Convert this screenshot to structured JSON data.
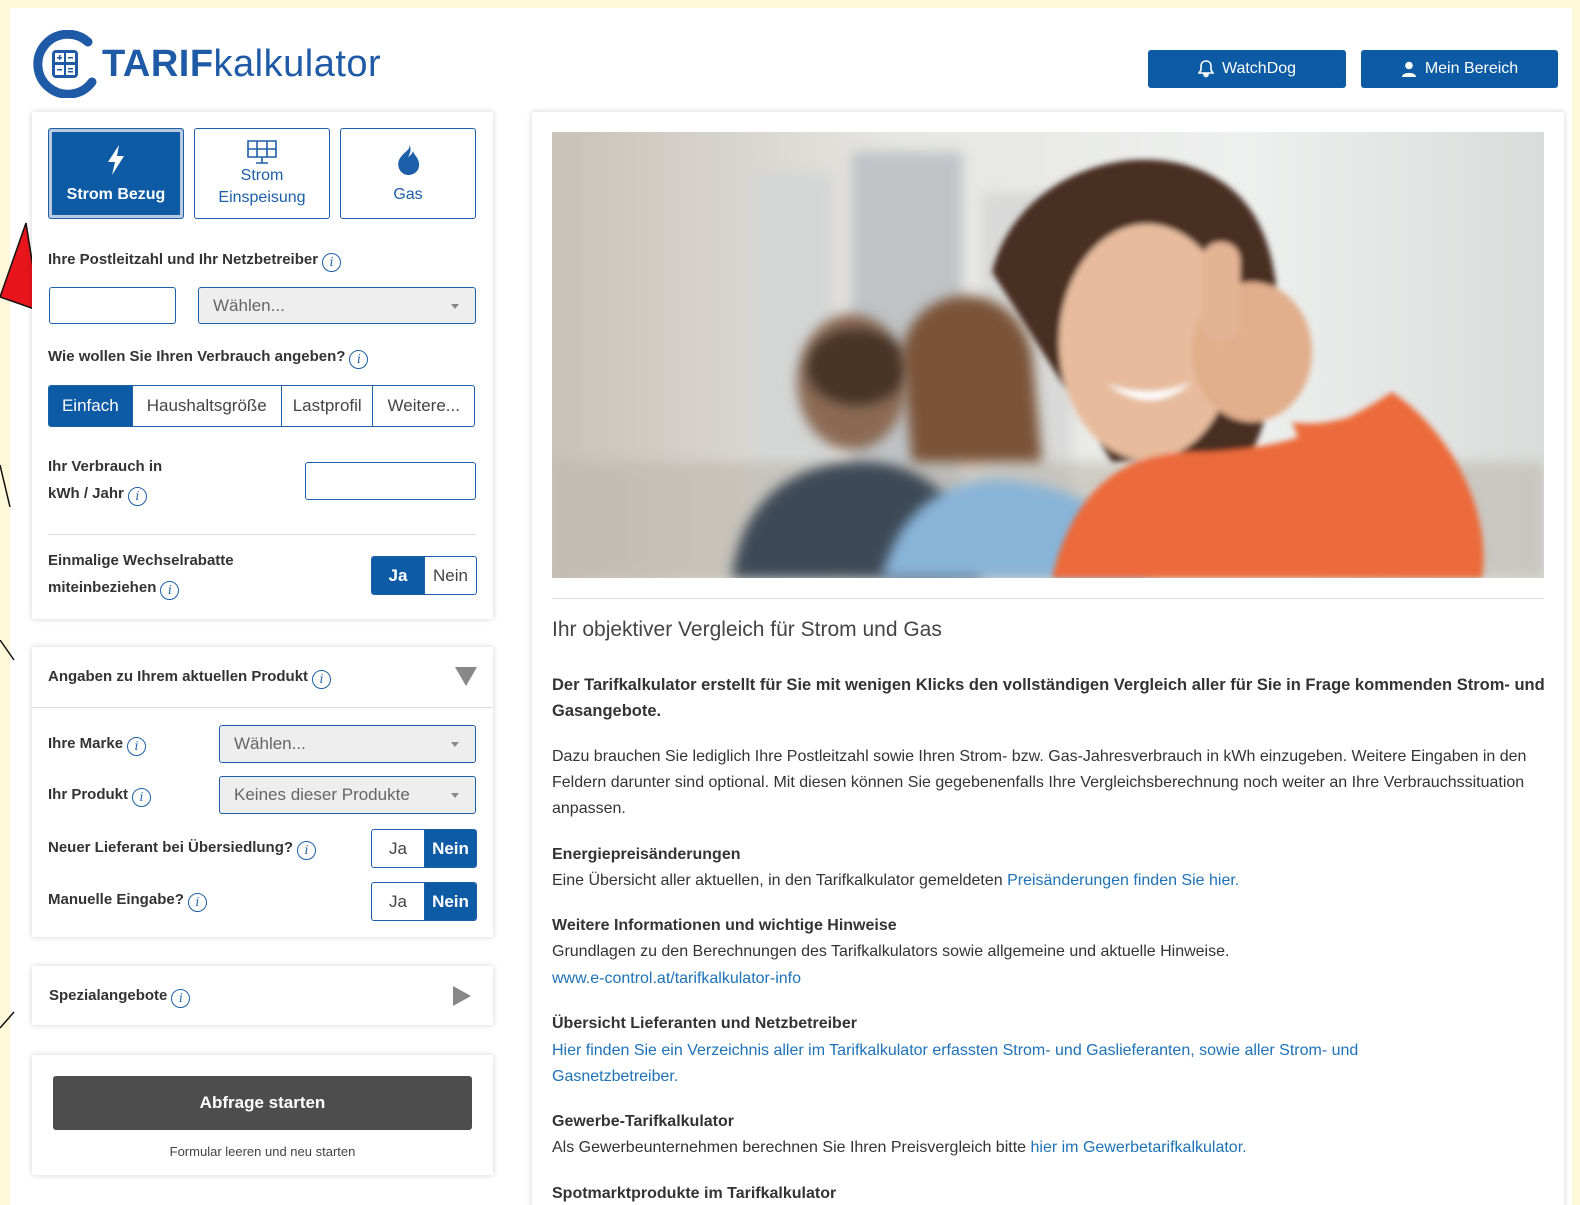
{
  "header": {
    "logo_bold": "TARIF",
    "logo_light": "kalkulator",
    "watchdog_label": "WatchDog",
    "mein_bereich_label": "Mein Bereich"
  },
  "energy_tabs": [
    {
      "label": "Strom Bezug",
      "icon": "lightning-icon"
    },
    {
      "label_line1": "Strom",
      "label_line2": "Einspeisung",
      "icon": "solar-panel-icon"
    },
    {
      "label": "Gas",
      "icon": "flame-icon"
    }
  ],
  "form": {
    "plz_label": "Ihre Postleitzahl und Ihr Netzbetreiber",
    "plz_value": "",
    "netzbetreiber_placeholder": "Wählen...",
    "verbrauch_question": "Wie wollen Sie Ihren Verbrauch angeben?",
    "verbrauch_options": [
      "Einfach",
      "Haushaltsgröße",
      "Lastprofil",
      "Weitere..."
    ],
    "verbrauch_selected": "Einfach",
    "verbrauch_label_line1": "Ihr Verbrauch in",
    "verbrauch_label_line2": "kWh / Jahr",
    "verbrauch_value": "",
    "rabatte_label_line1": "Einmalige Wechselrabatte",
    "rabatte_label_line2": "miteinbeziehen",
    "rabatte_options": [
      "Ja",
      "Nein"
    ],
    "rabatte_selected": "Ja"
  },
  "current_product": {
    "title": "Angaben zu Ihrem aktuellen Produkt",
    "marke_label": "Ihre Marke",
    "marke_placeholder": "Wählen...",
    "produkt_label": "Ihr Produkt",
    "produkt_value": "Keines dieser Produkte",
    "lieferant_label": "Neuer Lieferant bei Übersiedlung?",
    "lieferant_options": [
      "Ja",
      "Nein"
    ],
    "lieferant_selected": "Nein",
    "manuell_label": "Manuelle Eingabe?",
    "manuell_options": [
      "Ja",
      "Nein"
    ],
    "manuell_selected": "Nein"
  },
  "special": {
    "title": "Spezialangebote"
  },
  "actions": {
    "start_label": "Abfrage starten",
    "reset_label": "Formular leeren und neu starten"
  },
  "content": {
    "headline": "Ihr objektiver Vergleich für Strom und Gas",
    "intro_bold": "Der Tarifkalkulator erstellt für Sie mit wenigen Klicks den vollständigen Vergleich aller für Sie in Frage kommenden Strom- und Gasangebote.",
    "intro_text": "Dazu brauchen Sie lediglich Ihre Postleitzahl sowie Ihren Strom- bzw. Gas-Jahresverbrauch in kWh einzugeben. Weitere Eingaben in den Feldern darunter sind optional. Mit diesen können Sie gegebenenfalls Ihre Vergleichsberechnung noch weiter an Ihre Verbrauchssituation anpassen.",
    "sec1_title": "Energiepreisänderungen",
    "sec1_text": "Eine Übersicht aller aktuellen, in den Tarifkalkulator gemeldeten ",
    "sec1_link": "Preisänderungen finden Sie hier.",
    "sec2_title": "Weitere Informationen und wichtige Hinweise",
    "sec2_text": "Grundlagen zu den Berechnungen des Tarifkalkulators sowie allgemeine und aktuelle Hinweise.",
    "sec2_link": "www.e-control.at/tarifkalkulator-info",
    "sec3_title": "Übersicht Lieferanten und Netzbetreiber",
    "sec3_link": "Hier finden Sie ein Verzeichnis aller im Tarifkalkulator erfassten Strom- und Gaslieferanten, sowie aller Strom- und Gasnetzbetreiber.",
    "sec4_title": "Gewerbe-Tarifkalkulator",
    "sec4_text": "Als Gewerbeunternehmen berechnen Sie Ihren Preisvergleich bitte ",
    "sec4_link": "hier im Gewerbetarifkalkulator.",
    "sec5_title": "Spotmarktprodukte im Tarifkalkulator"
  },
  "colors": {
    "primary": "#0d5ba4",
    "link": "#1d72b8",
    "button_dark": "#4d4d4d",
    "page_bg": "#fff9d9"
  }
}
